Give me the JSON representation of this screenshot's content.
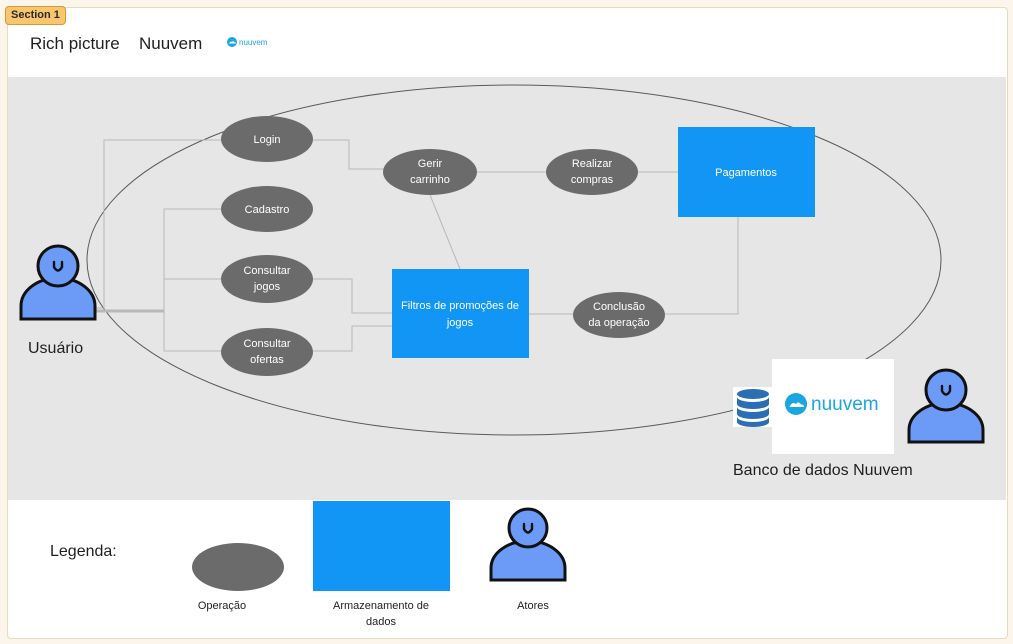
{
  "section": {
    "tag": "Section 1"
  },
  "header": {
    "title": "Rich picture",
    "brand": "Nuuvem",
    "logo_text": "nuuvem"
  },
  "nodes": {
    "login": [
      "Login"
    ],
    "cadastro": [
      "Cadastro"
    ],
    "consultar_jogos": [
      "Consultar",
      "jogos"
    ],
    "consultar_ofertas": [
      "Consultar",
      "ofertas"
    ],
    "gerir_carrinho": [
      "Gerir",
      "carrinho"
    ],
    "realizar_compras": [
      "Realizar",
      "compras"
    ],
    "conclusao": [
      "Conclusão",
      "da operação"
    ],
    "pagamentos": [
      "Pagamentos"
    ],
    "filtros": [
      "Filtros de promoções de",
      "jogos"
    ]
  },
  "actors": {
    "usuario": "Usuário",
    "banco": "Banco de dados Nuuvem"
  },
  "legend": {
    "title": "Legenda:",
    "operacao": [
      "Operação"
    ],
    "armazenamento": [
      "Armazenamento de",
      "dados"
    ],
    "atores": [
      "Atores"
    ]
  },
  "colors": {
    "operation": "#6b6b6b",
    "storage": "#1296f5",
    "actor_fill": "#6b9bf7",
    "actor_stroke": "#111111",
    "logo": "#1ba6e0",
    "connector": "#b8b8b8"
  },
  "icons": [
    "cloud-logo-icon",
    "database-icon",
    "person-icon"
  ]
}
